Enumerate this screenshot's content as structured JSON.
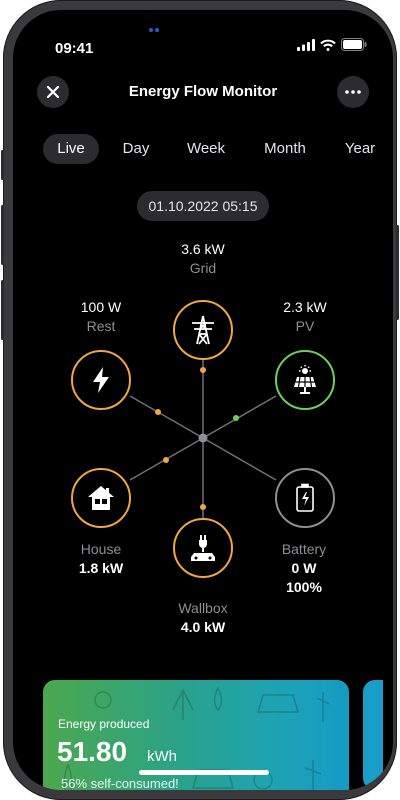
{
  "status": {
    "time": "09:41"
  },
  "header": {
    "title": "Energy Flow Monitor",
    "close_icon": "close-icon",
    "menu_icon": "more-dots-icon"
  },
  "tabs": [
    {
      "label": "Live",
      "active": true
    },
    {
      "label": "Day"
    },
    {
      "label": "Week"
    },
    {
      "label": "Month"
    },
    {
      "label": "Year"
    }
  ],
  "datetime": "01.10.2022 05:15",
  "nodes": {
    "grid": {
      "value": "3.6 kW",
      "name": "Grid",
      "color": "#f0a641",
      "icon": "power-tower-icon"
    },
    "rest": {
      "value": "100 W",
      "name": "Rest",
      "color": "#f0a641",
      "icon": "lightning-icon"
    },
    "pv": {
      "value": "2.3 kW",
      "name": "PV",
      "color": "#6fce5d",
      "icon": "solar-panel-icon"
    },
    "house": {
      "name": "House",
      "value": "1.8 kW",
      "color": "#f0a641",
      "icon": "house-icon"
    },
    "battery": {
      "name": "Battery",
      "value": "0 W",
      "percent": "100%",
      "color": "#8e8e93",
      "icon": "battery-charging-icon"
    },
    "wallbox": {
      "name": "Wallbox",
      "value": "4.0 kW",
      "color": "#f0a641",
      "icon": "ev-charger-icon"
    }
  },
  "card": {
    "label": "Energy produced",
    "value": "51.80",
    "unit": "kWh",
    "subtext": "56% self-consumed!"
  },
  "colors": {
    "accent_orange": "#f0a641",
    "accent_green": "#6fce5d",
    "inactive": "#8e8e93"
  }
}
